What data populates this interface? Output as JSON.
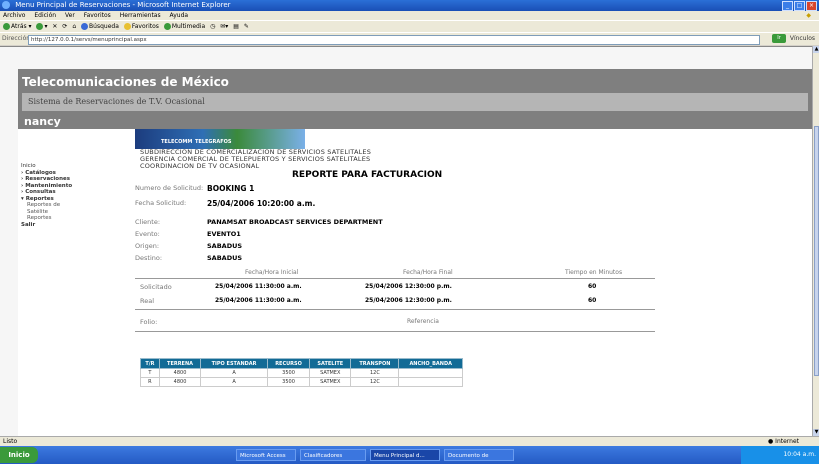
{
  "window": {
    "title": "Menu Principal de Reservaciones - Microsoft Internet Explorer"
  },
  "menu": [
    "Archivo",
    "Edición",
    "Ver",
    "Favoritos",
    "Herramientas",
    "Ayuda"
  ],
  "toolbar": {
    "back": "Atrás",
    "search": "Búsqueda",
    "favorites": "Favoritos",
    "media": "Multimedia"
  },
  "address": {
    "label": "Dirección",
    "url": "http://127.0.0.1/servs/menuprincipal.aspx",
    "go": "Ir",
    "links": "Vínculos"
  },
  "site": {
    "brand": "Telecomunicaciones de México",
    "subtitle": "Sistema de Reservaciones de T.V. Ocasional",
    "user": "nancy"
  },
  "nav": [
    {
      "label": "Inicio",
      "bold": false
    },
    {
      "label": "Catálogos",
      "bold": true
    },
    {
      "label": "Reservaciones",
      "bold": true
    },
    {
      "label": "Mantenimiento",
      "bold": true
    },
    {
      "label": "Consultas",
      "bold": true
    },
    {
      "label": "Reportes",
      "bold": true
    },
    {
      "label": "Reportes de Satélite",
      "bold": false,
      "sub": true
    },
    {
      "label": "Reportes",
      "bold": false,
      "sub": true
    },
    {
      "label": "Salir",
      "bold": true
    }
  ],
  "banner": {
    "left": "TELECOMM",
    "right": "TELEGRAFOS"
  },
  "report": {
    "dept1": "SUBDIRECCION DE COMERCIALIZACION DE SERVICIOS SATELITALES",
    "dept2": "GERENCIA COMERCIAL DE TELEPUERTOS Y SERVICIOS SATELITALES",
    "dept3": "COORDINACION DE TV OCASIONAL",
    "title": "REPORTE PARA FACTURACION",
    "fields": [
      {
        "label": "Numero de Solicitud:",
        "value": "BOOKING 1"
      },
      {
        "label": "Fecha Solicitud:",
        "value": "25/04/2006 10:20:00 a.m."
      },
      {
        "label": "Cliente:",
        "value": "PANAMSAT BROADCAST SERVICES DEPARTMENT"
      },
      {
        "label": "Evento:",
        "value": "EVENTO1"
      },
      {
        "label": "Origen:",
        "value": "SABADUS"
      },
      {
        "label": "Destino:",
        "value": "SABADUS"
      }
    ],
    "times": {
      "headers": [
        "Fecha/Hora Inicial",
        "Fecha/Hora Final",
        "Tiempo en Minutos"
      ],
      "rows": [
        {
          "label": "Solicitado",
          "start": "25/04/2006 11:30:00 a.m.",
          "end": "25/04/2006 12:30:00 p.m.",
          "minutes": "60"
        },
        {
          "label": "Real",
          "start": "25/04/2006 11:30:00 a.m.",
          "end": "25/04/2006 12:30:00 p.m.",
          "minutes": "60"
        }
      ]
    },
    "folio": {
      "label": "Folio:",
      "ref": "Referencia"
    },
    "table": {
      "headers": [
        "T/R",
        "TERRENA",
        "TIPO ESTANDAR",
        "RECURSO",
        "SATELITE",
        "TRANSPON",
        "ANCHO_BANDA"
      ],
      "rows": [
        [
          "T",
          "4800",
          "A",
          "3500",
          "SATMEX",
          "12C",
          ""
        ],
        [
          "R",
          "4800",
          "A",
          "3500",
          "SATMEX",
          "12C",
          ""
        ]
      ]
    }
  },
  "status": {
    "left": "Listo",
    "zone": "Internet"
  },
  "taskbar": {
    "start": "Inicio",
    "tasks": [
      "Microsoft Access",
      "Clasificadores",
      "Menu Principal d...",
      "Documento de Microso..."
    ],
    "clock": "10:04 a.m."
  }
}
